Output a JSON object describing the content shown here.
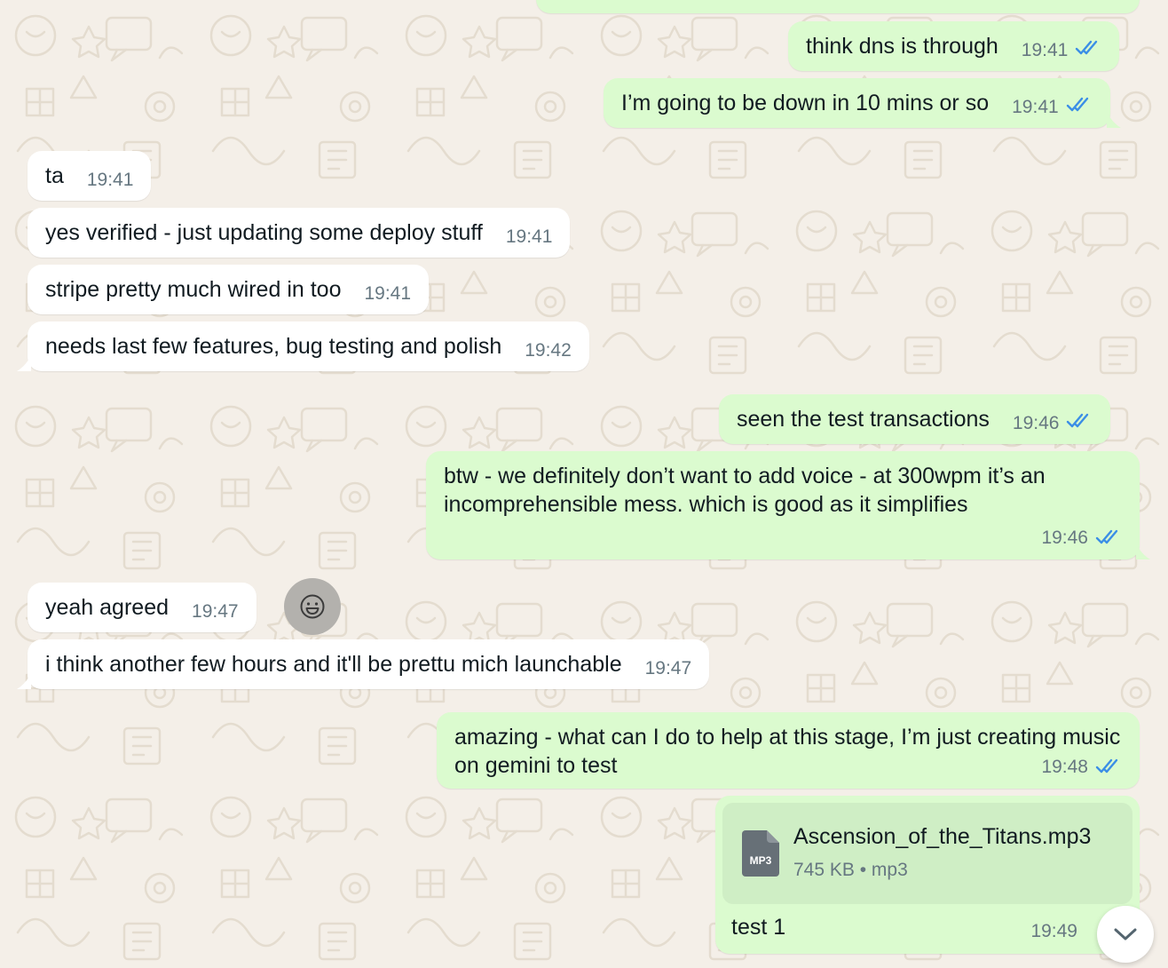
{
  "colors": {
    "background": "#f4efe8",
    "incoming_bubble": "#ffffff",
    "outgoing_bubble": "#dbfbcf",
    "read_ticks": "#3b8ee6",
    "timestamp": "#667781"
  },
  "messages": [
    {
      "direction": "outgoing",
      "text": "think dns is through",
      "time": "19:41",
      "status": "read"
    },
    {
      "direction": "outgoing",
      "text": "I’m going to be down in 10 mins or so",
      "time": "19:41",
      "status": "read"
    },
    {
      "direction": "incoming",
      "text": "ta",
      "time": "19:41"
    },
    {
      "direction": "incoming",
      "text": "yes verified - just updating some deploy stuff",
      "time": "19:41"
    },
    {
      "direction": "incoming",
      "text": "stripe pretty much wired in too",
      "time": "19:41"
    },
    {
      "direction": "incoming",
      "text": "needs last few features, bug testing and polish",
      "time": "19:42"
    },
    {
      "direction": "outgoing",
      "text": "seen the test transactions",
      "time": "19:46",
      "status": "read"
    },
    {
      "direction": "outgoing",
      "text": "btw - we definitely don’t want to add voice - at 300wpm it’s an incomprehensible mess.  which is good as it simplifies",
      "time": "19:46",
      "status": "read"
    },
    {
      "direction": "incoming",
      "text": "yeah agreed",
      "time": "19:47"
    },
    {
      "direction": "incoming",
      "text": "i think another few hours and it'll be prettu mich launchable",
      "time": "19:47"
    },
    {
      "direction": "outgoing",
      "text": "amazing - what can I do to help at this stage, I’m just creating music on gemini to test",
      "time": "19:48",
      "status": "read"
    },
    {
      "direction": "outgoing",
      "type": "file",
      "file_name": "Ascension_of_the_Titans.mp3",
      "file_size": "745 KB",
      "file_type": "mp3",
      "file_icon_label": "MP3",
      "caption": "test 1",
      "time": "19:49"
    }
  ],
  "icons": {
    "emoji": "smiley-face-icon",
    "scroll_down": "chevron-down-icon",
    "read_receipt": "double-check-icon"
  }
}
